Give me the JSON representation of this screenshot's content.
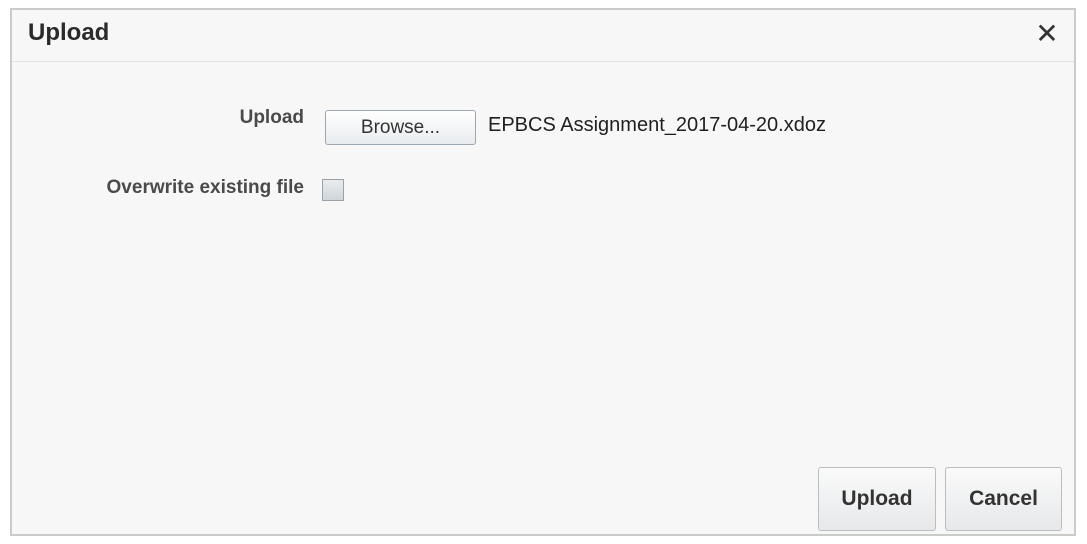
{
  "dialog": {
    "title": "Upload",
    "close_glyph": "✕",
    "close_icon": "close-icon"
  },
  "form": {
    "upload_label": "Upload",
    "browse_label": "Browse...",
    "file_name": "EPBCS Assignment_2017-04-20.xdoz",
    "overwrite_label": "Overwrite existing file",
    "overwrite_checked": false
  },
  "footer": {
    "upload_button": "Upload",
    "cancel_button": "Cancel"
  }
}
